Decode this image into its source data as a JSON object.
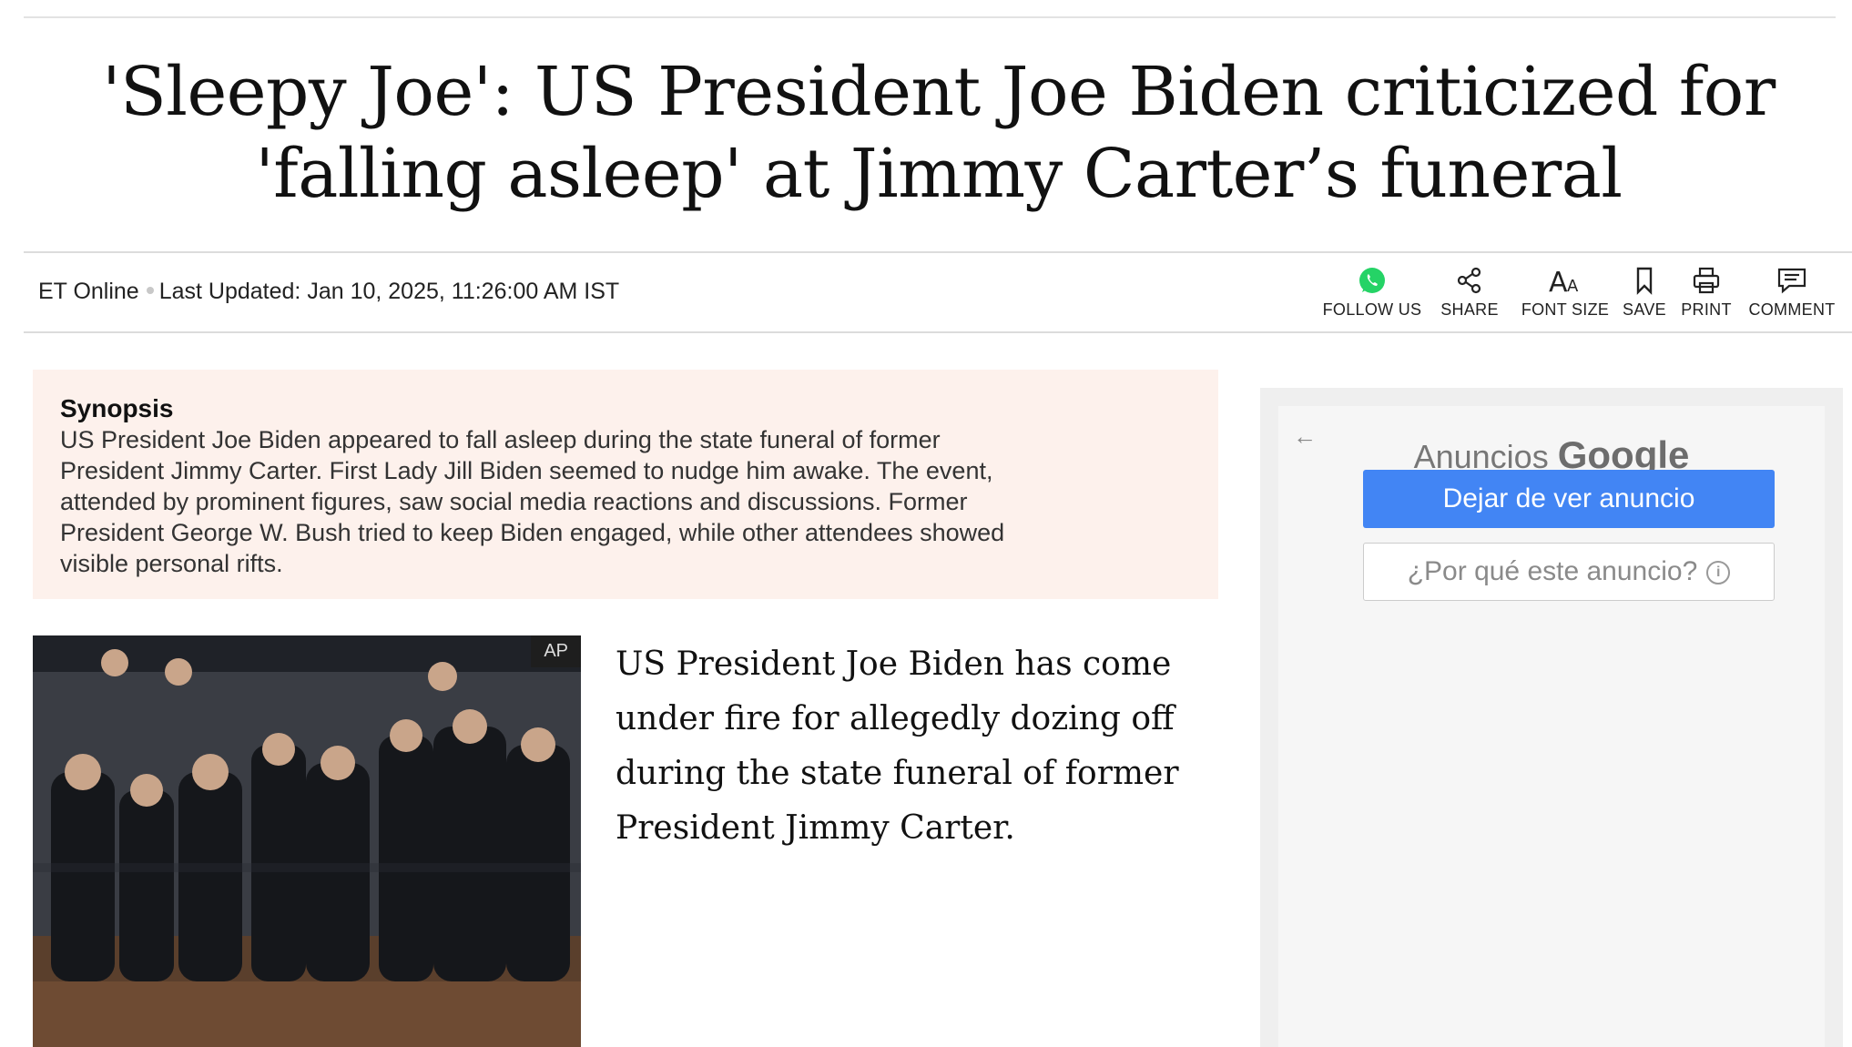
{
  "article": {
    "headline_line1": "'Sleepy Joe': US President Joe Biden criticized for",
    "headline_line2": "'falling asleep' at Jimmy Carter’s funeral",
    "author": "ET Online",
    "last_updated": "Last Updated: Jan 10, 2025, 11:26:00 AM IST",
    "synopsis_title": "Synopsis",
    "synopsis_lines": [
      "US President Joe Biden appeared to fall asleep during the state funeral of former",
      "President Jimmy Carter. First Lady Jill Biden seemed to nudge him awake. The event,",
      "attended by prominent figures, saw social media reactions and discussions. Former",
      "President George W. Bush tried to keep Biden engaged, while other attendees showed",
      "visible personal rifts."
    ],
    "image_credit": "AP",
    "lede": "US President Joe Biden has come under fire for allegedly dozing off during the state funeral of former President Jimmy Carter."
  },
  "toolbar": {
    "follow_us": "FOLLOW US",
    "share": "SHARE",
    "font_size": "FONT SIZE",
    "save": "SAVE",
    "print": "PRINT",
    "comment": "COMMENT",
    "icons": [
      "whatsapp-icon",
      "share-icon",
      "font-size-icon",
      "bookmark-icon",
      "print-icon",
      "comment-icon"
    ]
  },
  "ad": {
    "label_prefix": "Anuncios",
    "label_brand": "Google",
    "stop_button": "Dejar de ver anuncio",
    "why_button": "¿Por qué este anuncio?",
    "back_icon": "arrow-left-icon",
    "info_icon": "info-icon"
  },
  "colors": {
    "whatsapp": "#25d366",
    "synopsis_bg": "#fdf1ec",
    "ad_button": "#4285f4"
  }
}
